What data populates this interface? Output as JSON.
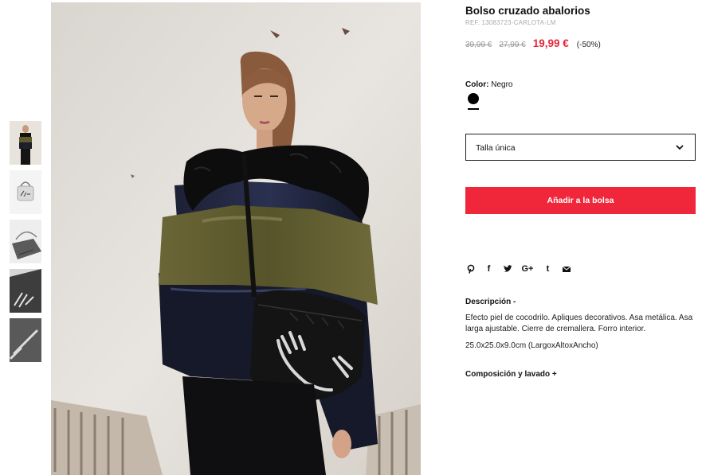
{
  "product": {
    "title": "Bolso cruzado abalorios",
    "ref": "REF. 13083723-CARLOTA-LM",
    "price_old_1": "39,99 €",
    "price_old_2": "27,99 €",
    "price_now": "19,99 €",
    "discount": "(-50%)",
    "accent_color": "#e5263a"
  },
  "color": {
    "label": "Color:",
    "value": "Negro",
    "swatch_hex": "#000000"
  },
  "size": {
    "selected": "Talla única",
    "icon": "chevron-down-icon"
  },
  "cta": {
    "label": "Añadir a la bolsa",
    "bg": "#f0263b"
  },
  "share": {
    "icons": [
      "pinterest-icon",
      "facebook-icon",
      "twitter-icon",
      "google-plus-icon",
      "tumblr-icon",
      "email-icon"
    ],
    "glyphs": {
      "facebook": "f",
      "google_plus": "G+",
      "tumblr": "t"
    }
  },
  "description": {
    "heading": "Descripción -",
    "text": "Efecto piel de cocodrilo. Apliques decorativos. Asa metálica. Asa larga ajustable. Cierre de cremallera. Forro interior.",
    "dimensions": "25.0x25.0x9.0cm (LargoxAltoxAncho)"
  },
  "composition": {
    "heading": "Composición y lavado +"
  }
}
